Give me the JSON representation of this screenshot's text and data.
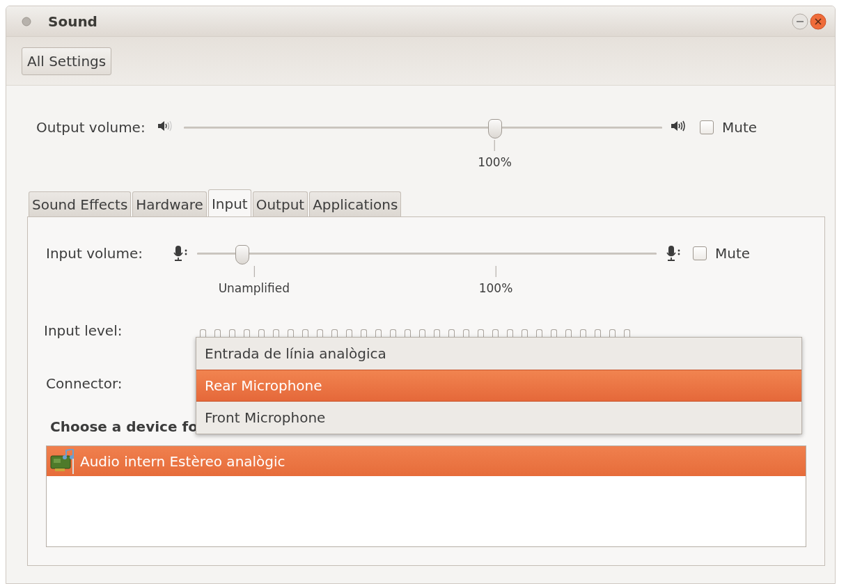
{
  "window": {
    "title": "Sound"
  },
  "toolbar": {
    "button": "All Settings"
  },
  "output_volume": {
    "label": "Output volume:",
    "level": 0.65,
    "marks": [
      {
        "label": "100%"
      }
    ],
    "mute": {
      "label": "Mute",
      "checked": false
    }
  },
  "tabs": [
    {
      "label": "Sound Effects",
      "selected": false
    },
    {
      "label": "Hardware",
      "selected": false
    },
    {
      "label": "Input",
      "selected": true
    },
    {
      "label": "Output",
      "selected": false
    },
    {
      "label": "Applications",
      "selected": false
    }
  ],
  "input_volume": {
    "label": "Input volume:",
    "level": 0.098,
    "marks": [
      {
        "label": "Unamplified"
      },
      {
        "label": "100%"
      }
    ],
    "mute": {
      "label": "Mute",
      "checked": false
    }
  },
  "input_level": {
    "label": "Input level:",
    "level": 0
  },
  "connector": {
    "label": "Connector:",
    "menu": [
      {
        "label": "Entrada de línia analògica",
        "selected": false
      },
      {
        "label": "Rear Microphone",
        "selected": true
      },
      {
        "label": "Front Microphone",
        "selected": false
      }
    ]
  },
  "devices": {
    "label": "Choose a device fo",
    "items": [
      {
        "name": "Audio intern Estèreo analògic",
        "selected": true
      }
    ]
  }
}
